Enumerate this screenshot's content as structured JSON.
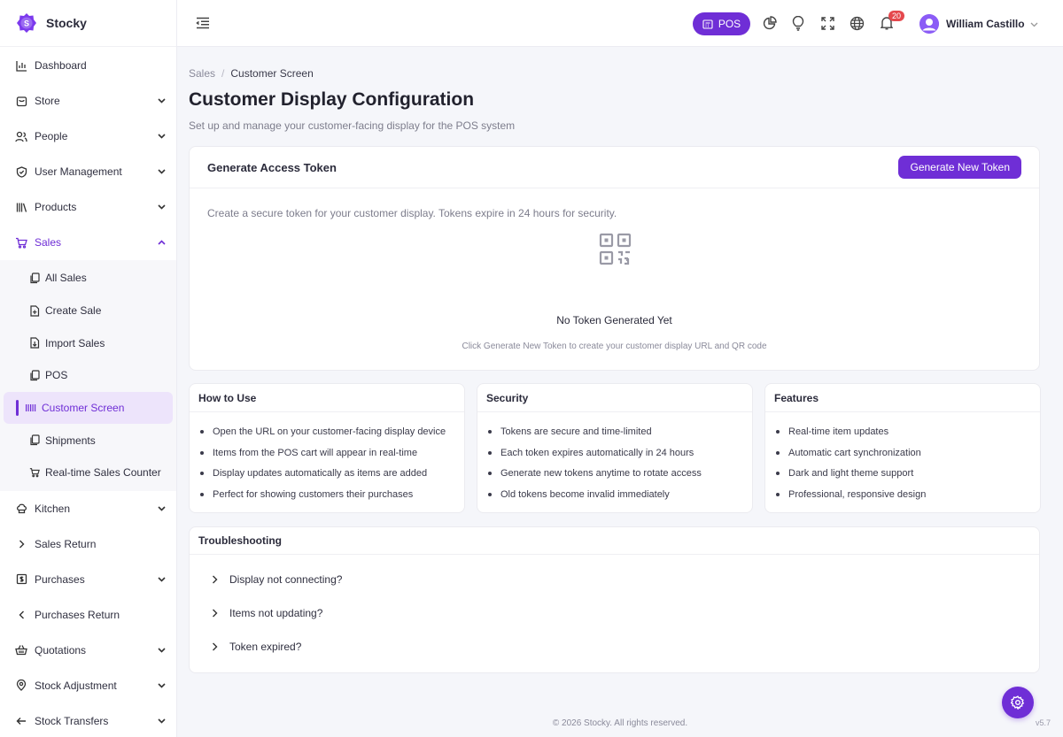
{
  "brand": {
    "name": "Stocky",
    "logo_letter": "S"
  },
  "sidebar": {
    "items": [
      {
        "label": "Dashboard"
      },
      {
        "label": "Store"
      },
      {
        "label": "People"
      },
      {
        "label": "User Management"
      },
      {
        "label": "Products"
      },
      {
        "label": "Sales"
      },
      {
        "label": "Kitchen"
      },
      {
        "label": "Sales Return"
      },
      {
        "label": "Purchases"
      },
      {
        "label": "Purchases Return"
      },
      {
        "label": "Quotations"
      },
      {
        "label": "Stock Adjustment"
      },
      {
        "label": "Stock Transfers"
      }
    ],
    "sales_sub": [
      {
        "label": "All Sales"
      },
      {
        "label": "Create Sale"
      },
      {
        "label": "Import Sales"
      },
      {
        "label": "POS"
      },
      {
        "label": "Customer Screen"
      },
      {
        "label": "Shipments"
      },
      {
        "label": "Real-time Sales Counter"
      }
    ]
  },
  "topbar": {
    "pos_label": "POS",
    "notification_count": "20",
    "user_name": "William Castillo"
  },
  "breadcrumb": {
    "parent": "Sales",
    "separator": "/",
    "current": "Customer Screen"
  },
  "page": {
    "title": "Customer Display Configuration",
    "subtitle": "Set up and manage your customer-facing display for the POS system"
  },
  "token_card": {
    "title": "Generate Access Token",
    "button": "Generate New Token",
    "description": "Create a secure token for your customer display. Tokens expire in 24 hours for security.",
    "empty_title": "No Token Generated Yet",
    "empty_subtitle": "Click Generate New Token to create your customer display URL and QR code"
  },
  "how_to_use": {
    "title": "How to Use",
    "items": [
      "Open the URL on your customer-facing display device",
      "Items from the POS cart will appear in real-time",
      "Display updates automatically as items are added",
      "Perfect for showing customers their purchases"
    ]
  },
  "security": {
    "title": "Security",
    "items": [
      "Tokens are secure and time-limited",
      "Each token expires automatically in 24 hours",
      "Generate new tokens anytime to rotate access",
      "Old tokens become invalid immediately"
    ]
  },
  "features": {
    "title": "Features",
    "items": [
      "Real-time item updates",
      "Automatic cart synchronization",
      "Dark and light theme support",
      "Professional, responsive design"
    ]
  },
  "troubleshooting": {
    "title": "Troubleshooting",
    "items": [
      "Display not connecting?",
      "Items not updating?",
      "Token expired?"
    ]
  },
  "footer": {
    "copyright": "© 2026 Stocky. All rights reserved.",
    "version": "v5.7"
  },
  "colors": {
    "accent": "#6f2ed6",
    "badge": "#e5484d"
  }
}
